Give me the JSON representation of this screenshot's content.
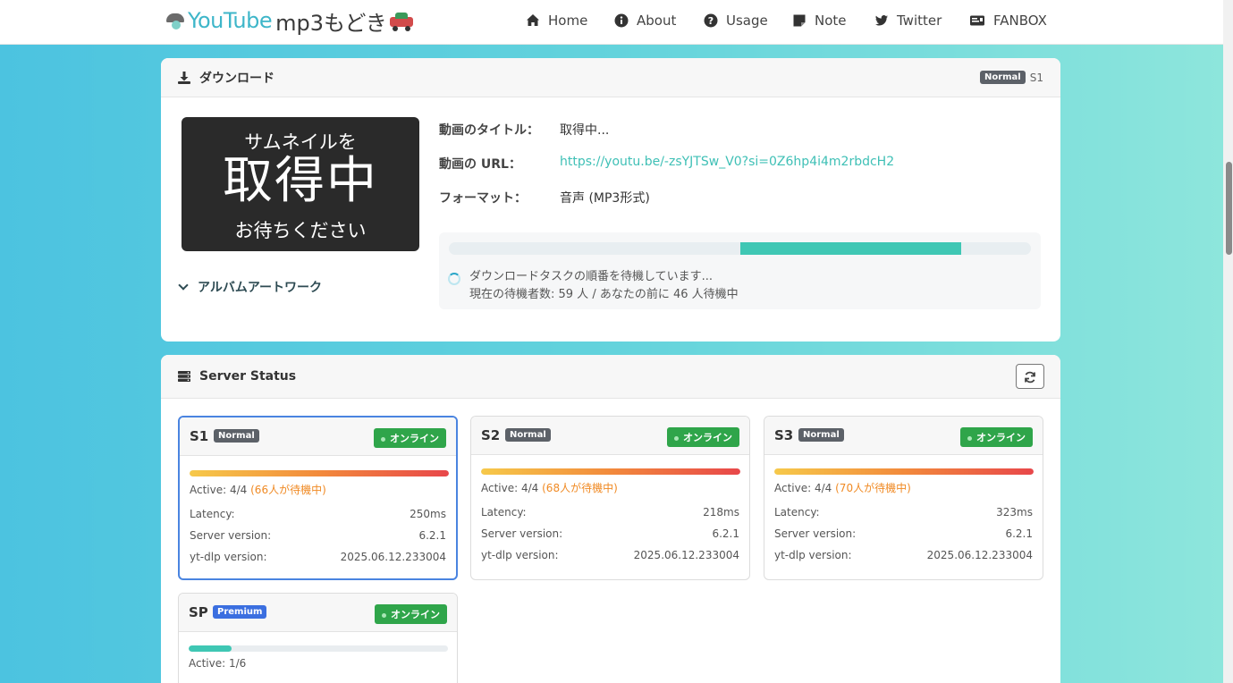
{
  "logo": {
    "part1": "YouTube",
    "part2": "mp3もどき"
  },
  "nav": [
    {
      "id": "home",
      "label": "Home",
      "icon": "home-icon"
    },
    {
      "id": "about",
      "label": "About",
      "icon": "info-circle-icon"
    },
    {
      "id": "usage",
      "label": "Usage",
      "icon": "question-circle-icon"
    },
    {
      "id": "note",
      "label": "Note",
      "icon": "note-icon"
    },
    {
      "id": "twitter",
      "label": "Twitter",
      "icon": "twitter-icon"
    },
    {
      "id": "fanbox",
      "label": "FANBOX",
      "icon": "id-card-icon"
    }
  ],
  "download": {
    "title": "ダウンロード",
    "tier_badge": "Normal",
    "server": "S1",
    "thumbnail": {
      "line1": "サムネイルを",
      "line2": "取得中",
      "line3": "お待ちください"
    },
    "labels": {
      "title": "動画のタイトル：",
      "url": "動画の URL：",
      "format": "フォーマット："
    },
    "values": {
      "title": "取得中...",
      "url": "https://youtu.be/-zsYJTSw_V0?si=0Z6hp4i4m2rbdcH2",
      "format": "音声 (MP3形式)"
    },
    "progress": {
      "fill_start": 0.5,
      "fill_end": 0.88
    },
    "status_line1": "ダウンロードタスクの順番を待機しています...",
    "status_line2": "現在の待機者数: 59 人 / あなたの前に 46 人待機中",
    "album_toggle": "アルバムアートワーク"
  },
  "server_status": {
    "title": "Server Status",
    "online_label": "オンライン",
    "labels": {
      "latency": "Latency:",
      "server_version": "Server version:",
      "ytdlp_version": "yt-dlp version:"
    },
    "servers": [
      {
        "name": "S1",
        "tier": "Normal",
        "active": "Active: 4/4",
        "queue": "(66人が待機中)",
        "load": 1.0,
        "latency": "250ms",
        "server_version": "6.2.1",
        "ytdlp_version": "2025.06.12.233004"
      },
      {
        "name": "S2",
        "tier": "Normal",
        "active": "Active: 4/4",
        "queue": "(68人が待機中)",
        "load": 1.0,
        "latency": "218ms",
        "server_version": "6.2.1",
        "ytdlp_version": "2025.06.12.233004"
      },
      {
        "name": "S3",
        "tier": "Normal",
        "active": "Active: 4/4",
        "queue": "(70人が待機中)",
        "load": 1.0,
        "latency": "323ms",
        "server_version": "6.2.1",
        "ytdlp_version": "2025.06.12.233004"
      },
      {
        "name": "SP",
        "tier": "Premium",
        "active": "Active: 1/6",
        "load": 0.1667
      }
    ]
  },
  "colors": {
    "accent": "#3fc7b4",
    "link": "#3fc0b6",
    "online": "#2fa54a",
    "premium": "#3b6fe0",
    "queue": "#f08a24"
  }
}
